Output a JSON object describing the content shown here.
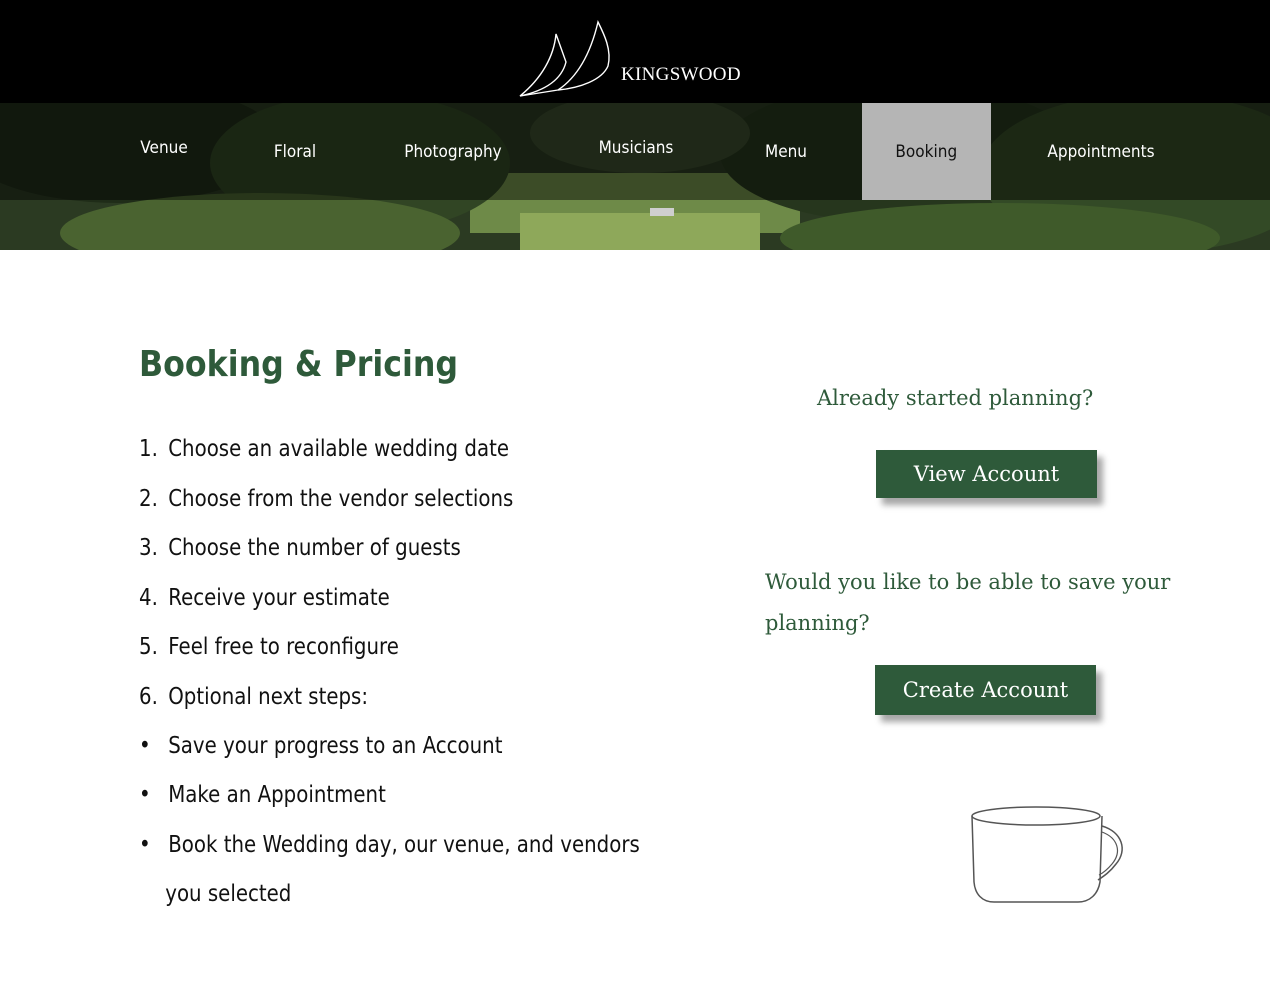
{
  "header": {
    "brand": "KINGSWOOD"
  },
  "nav": {
    "items": [
      {
        "label": "Venue"
      },
      {
        "label": "Floral"
      },
      {
        "label": "Photography"
      },
      {
        "label": "Musicians"
      },
      {
        "label": "Menu"
      },
      {
        "label": "Booking"
      },
      {
        "label": "Appointments"
      }
    ],
    "active": "Booking"
  },
  "main": {
    "title": "Booking & Pricing",
    "steps": [
      {
        "num": "1.",
        "text": "Choose an available wedding date"
      },
      {
        "num": "2.",
        "text": "Choose from the vendor selections"
      },
      {
        "num": "3.",
        "text": "Choose the number of guests"
      },
      {
        "num": "4.",
        "text": "Receive your estimate"
      },
      {
        "num": "5.",
        "text": "Feel free to reconfigure"
      },
      {
        "num": "6.",
        "text": "Optional next steps:"
      }
    ],
    "bullets": [
      {
        "text": "Save your progress to an Account"
      },
      {
        "text": "Make an Appointment"
      },
      {
        "text": "Book the Wedding day, our venue, and vendors"
      }
    ],
    "bullet_continuation": "you selected"
  },
  "side": {
    "already_question": "Already started planning?",
    "view_account": "View Account",
    "save_question": "Would you like to be able to save your planning?",
    "create_account": "Create Account"
  },
  "colors": {
    "accent": "#2e5a3a",
    "topbar": "#000000",
    "active_tab": "#b5b5b5"
  }
}
